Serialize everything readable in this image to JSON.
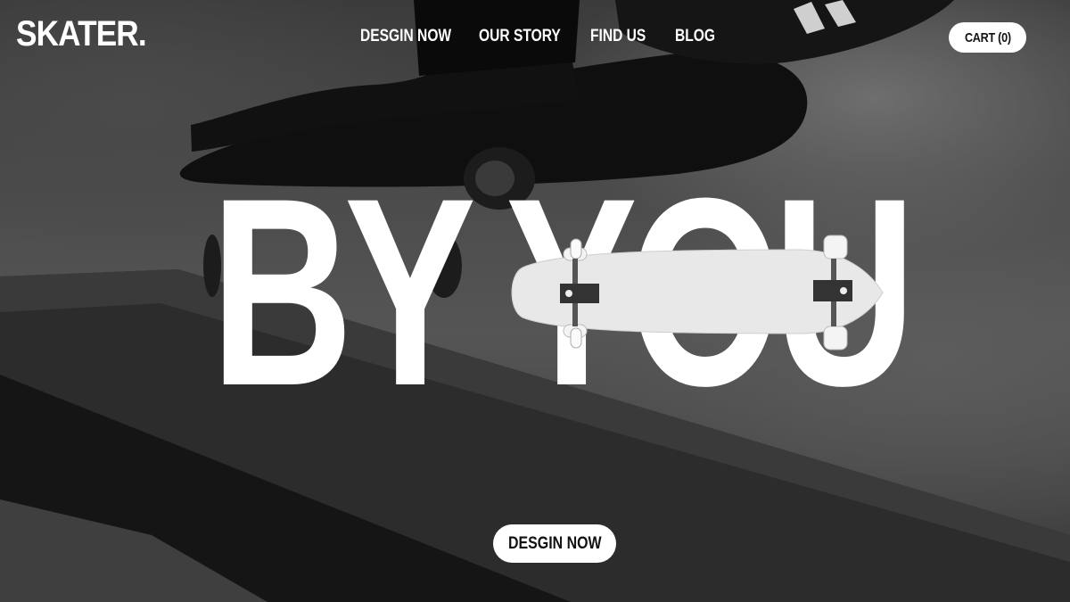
{
  "brand": {
    "logo": "SKATER."
  },
  "nav": {
    "items": [
      {
        "label": "DESGIN NOW"
      },
      {
        "label": "OUR STORY"
      },
      {
        "label": "FIND US"
      },
      {
        "label": "BLOG"
      }
    ],
    "cart_label": "CART (0)"
  },
  "hero": {
    "headline": "BY YOU",
    "cta_label": "DESGIN NOW"
  },
  "colors": {
    "text": "#ffffff",
    "button_bg": "#ffffff",
    "button_text": "#111111",
    "background": "#3a3a3a"
  },
  "icons": [
    "skateboard-photo",
    "longboard-image"
  ]
}
